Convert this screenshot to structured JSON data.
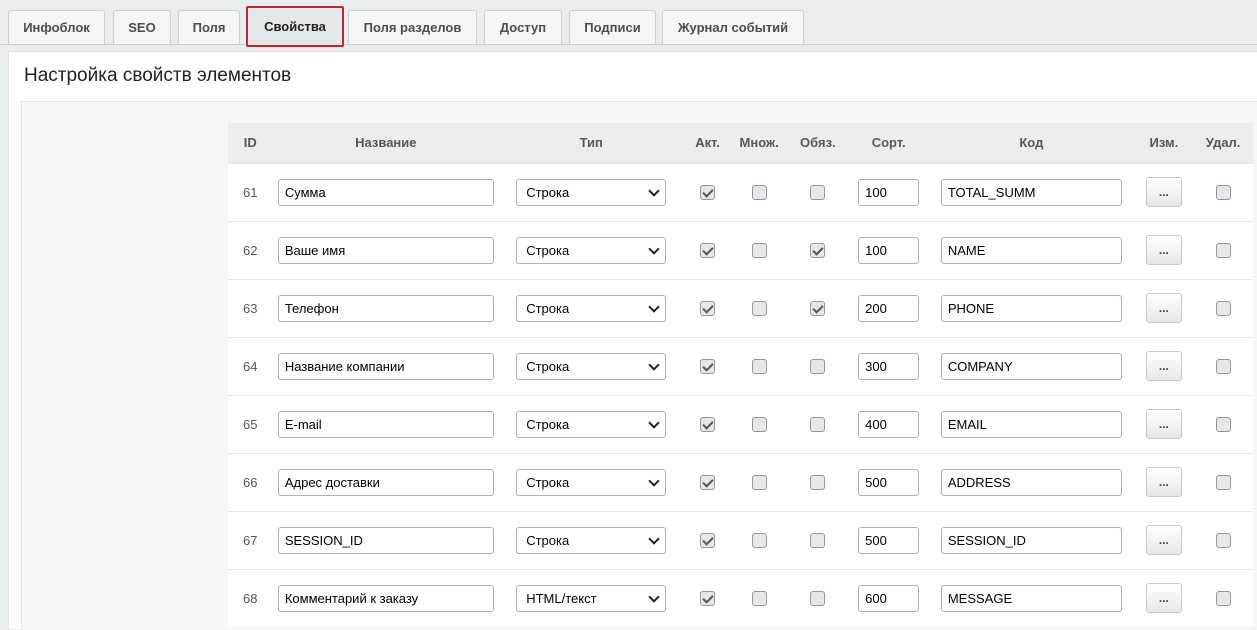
{
  "tabs": [
    "Инфоблок",
    "SEO",
    "Поля",
    "Свойства",
    "Поля разделов",
    "Доступ",
    "Подписи",
    "Журнал событий"
  ],
  "active_tab": "Свойства",
  "page_title": "Настройка свойств элементов",
  "table": {
    "headers": {
      "id": "ID",
      "name": "Название",
      "type": "Тип",
      "active": "Акт.",
      "multiple": "Множ.",
      "required": "Обяз.",
      "sort": "Сорт.",
      "code": "Код",
      "edit": "Изм.",
      "delete": "Удал."
    },
    "edit_button_label": "...",
    "rows": [
      {
        "id": "61",
        "name": "Сумма",
        "type": "Строка",
        "active": true,
        "multiple": false,
        "required": false,
        "sort": "100",
        "code": "TOTAL_SUMM",
        "delete": false
      },
      {
        "id": "62",
        "name": "Ваше имя",
        "type": "Строка",
        "active": true,
        "multiple": false,
        "required": true,
        "sort": "100",
        "code": "NAME",
        "delete": false
      },
      {
        "id": "63",
        "name": "Телефон",
        "type": "Строка",
        "active": true,
        "multiple": false,
        "required": true,
        "sort": "200",
        "code": "PHONE",
        "delete": false
      },
      {
        "id": "64",
        "name": "Название компании",
        "type": "Строка",
        "active": true,
        "multiple": false,
        "required": false,
        "sort": "300",
        "code": "COMPANY",
        "delete": false
      },
      {
        "id": "65",
        "name": "E-mail",
        "type": "Строка",
        "active": true,
        "multiple": false,
        "required": false,
        "sort": "400",
        "code": "EMAIL",
        "delete": false
      },
      {
        "id": "66",
        "name": "Адрес доставки",
        "type": "Строка",
        "active": true,
        "multiple": false,
        "required": false,
        "sort": "500",
        "code": "ADDRESS",
        "delete": false
      },
      {
        "id": "67",
        "name": "SESSION_ID",
        "type": "Строка",
        "active": true,
        "multiple": false,
        "required": false,
        "sort": "500",
        "code": "SESSION_ID",
        "delete": false
      },
      {
        "id": "68",
        "name": "Комментарий к заказу",
        "type": "HTML/текст",
        "active": true,
        "multiple": false,
        "required": false,
        "sort": "600",
        "code": "MESSAGE",
        "delete": false
      }
    ]
  },
  "colors": {
    "active_tab_border": "#c0262d",
    "background": "#e7ecee"
  }
}
